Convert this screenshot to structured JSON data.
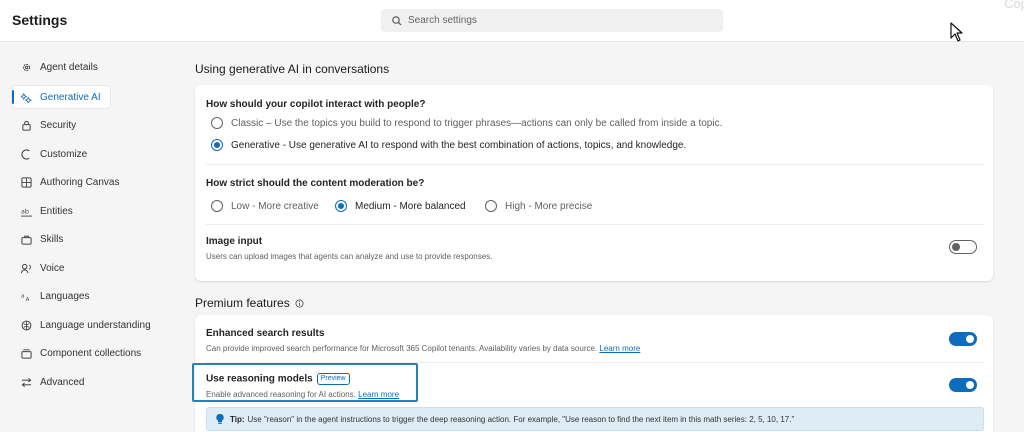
{
  "header": {
    "title": "Settings",
    "search_placeholder": "Search settings",
    "corner_text": "Cop"
  },
  "sidebar": {
    "items": [
      {
        "label": "Agent details",
        "icon": "gear-icon",
        "active": false
      },
      {
        "label": "Generative AI",
        "icon": "sparkle-icon",
        "active": true
      },
      {
        "label": "Security",
        "icon": "lock-icon",
        "active": false
      },
      {
        "label": "Customize",
        "icon": "palette-icon",
        "active": false
      },
      {
        "label": "Authoring Canvas",
        "icon": "grid-icon",
        "active": false
      },
      {
        "label": "Entities",
        "icon": "abc-icon",
        "active": false
      },
      {
        "label": "Skills",
        "icon": "toolbox-icon",
        "active": false
      },
      {
        "label": "Voice",
        "icon": "voice-icon",
        "active": false
      },
      {
        "label": "Languages",
        "icon": "translate-icon",
        "active": false
      },
      {
        "label": "Language understanding",
        "icon": "brain-icon",
        "active": false
      },
      {
        "label": "Component collections",
        "icon": "collection-icon",
        "active": false
      },
      {
        "label": "Advanced",
        "icon": "sliders-icon",
        "active": false
      }
    ]
  },
  "main": {
    "section1_title": "Using generative AI in conversations",
    "interact": {
      "question": "How should your copilot interact with people?",
      "options": [
        {
          "label": "Classic – Use the topics you build to respond to trigger phrases—actions can only be called from inside a topic.",
          "checked": false
        },
        {
          "label": "Generative - Use generative AI to respond with the best combination of actions, topics, and knowledge.",
          "checked": true
        }
      ]
    },
    "moderation": {
      "question": "How strict should the content moderation be?",
      "options": [
        {
          "label": "Low - More creative",
          "checked": false
        },
        {
          "label": "Medium - More balanced",
          "checked": true
        },
        {
          "label": "High - More precise",
          "checked": false
        }
      ]
    },
    "image_input": {
      "title": "Image input",
      "description": "Users can upload images that agents can analyze and use to provide responses.",
      "enabled": false
    },
    "section2_title": "Premium features",
    "enhanced_search": {
      "title": "Enhanced search results",
      "description": "Can provide improved search performance for Microsoft 365 Copilot tenants. Availability varies by data source.",
      "link": "Learn more",
      "enabled": true
    },
    "reasoning": {
      "title": "Use reasoning models",
      "badge": "Preview",
      "description": "Enable advanced reasoning for AI actions.",
      "link": "Learn more",
      "enabled": true
    },
    "tip": {
      "label": "Tip:",
      "text": "Use \"reason\" in the agent instructions to trigger the deep reasoning action. For example, \"Use reason to find the next item in this math series: 2, 5, 10, 17.\""
    }
  },
  "colors": {
    "accent": "#0f6cbd",
    "highlight_border": "#2a7fb5",
    "tip_background": "#deecf5"
  }
}
